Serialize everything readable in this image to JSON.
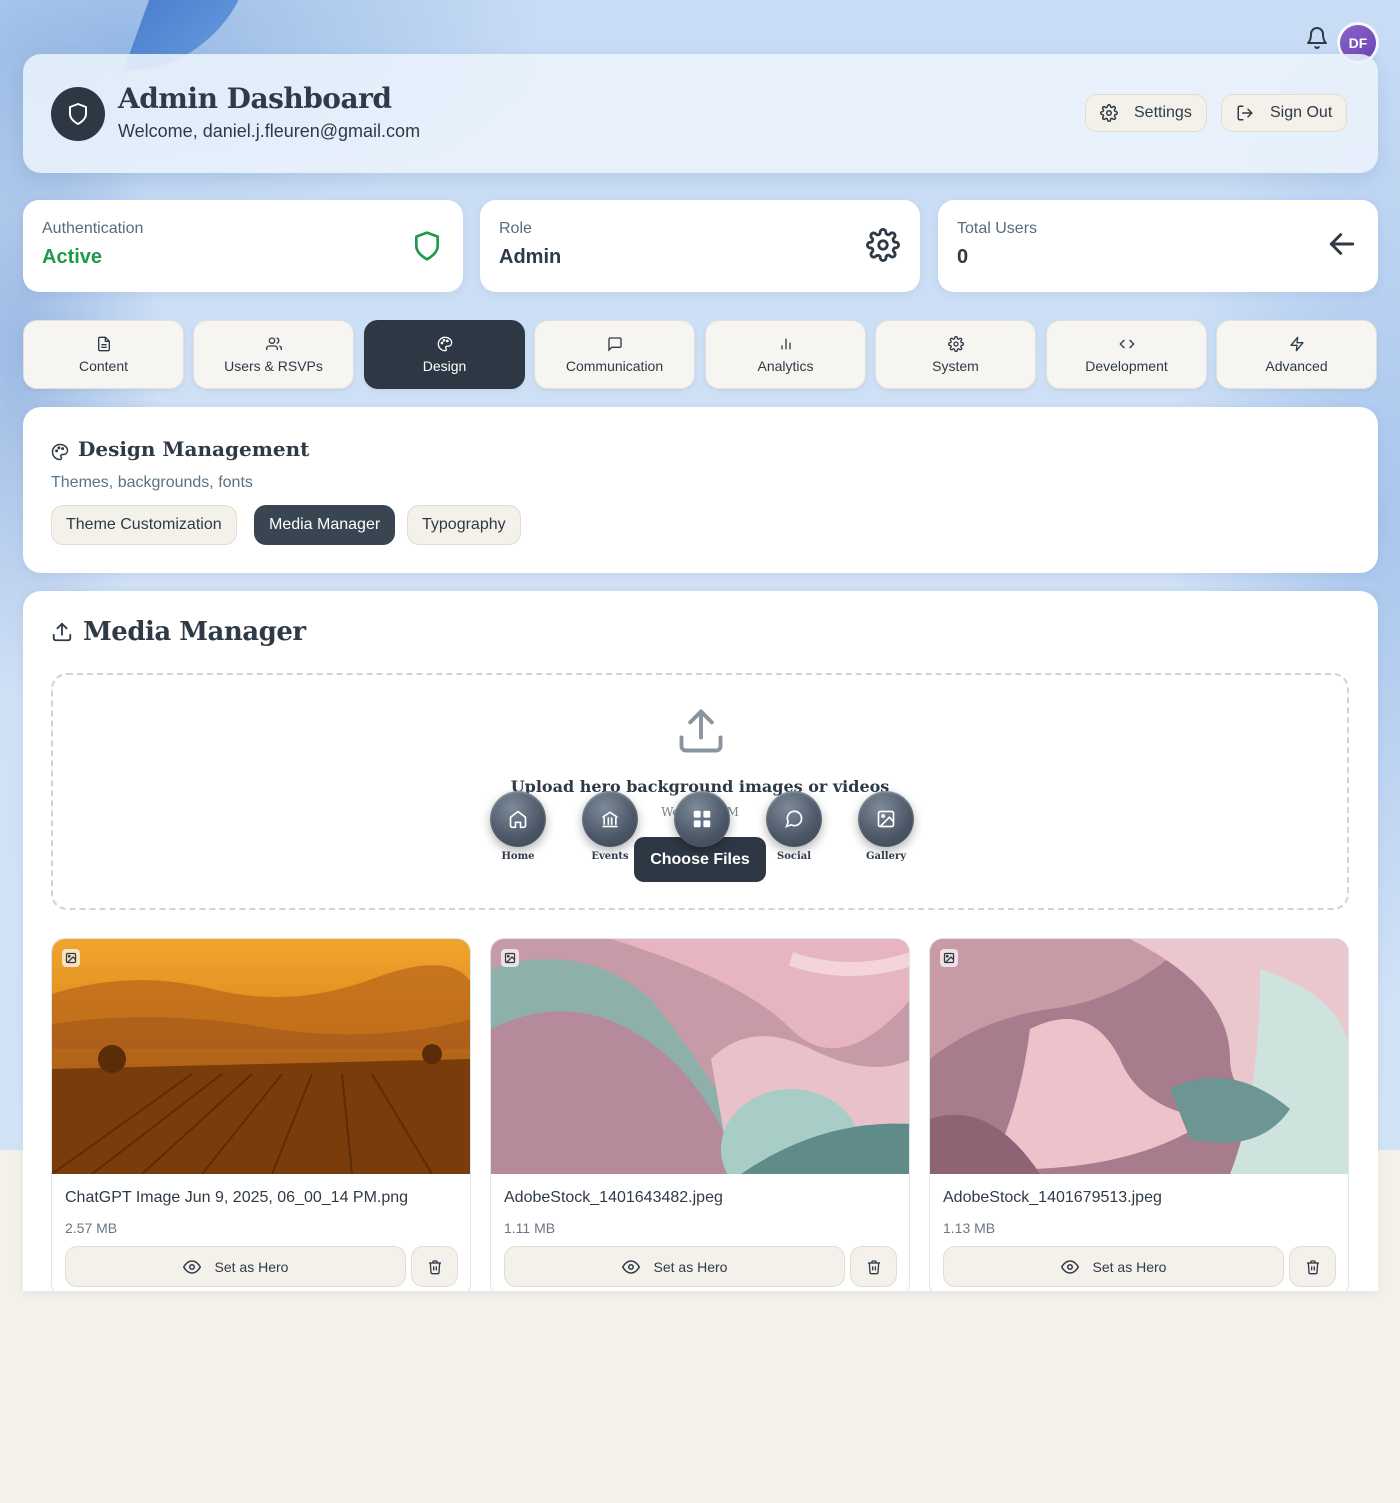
{
  "user": {
    "initials": "DF"
  },
  "header": {
    "title": "Admin Dashboard",
    "welcome": "Welcome, daniel.j.fleuren@gmail.com",
    "settings_label": "Settings",
    "signout_label": "Sign Out"
  },
  "stats": [
    {
      "label": "Authentication",
      "value": "Active",
      "icon": "shield-icon",
      "value_color": "#1f9a4a"
    },
    {
      "label": "Role",
      "value": "Admin",
      "icon": "gear-icon"
    },
    {
      "label": "Total Users",
      "value": "0",
      "icon": "arrow-left-icon"
    }
  ],
  "nav_tabs": [
    {
      "label": "Content",
      "icon": "document-icon"
    },
    {
      "label": "Users & RSVPs",
      "icon": "users-icon"
    },
    {
      "label": "Design",
      "icon": "palette-icon",
      "active": true
    },
    {
      "label": "Communication",
      "icon": "chat-icon"
    },
    {
      "label": "Analytics",
      "icon": "bar-chart-icon"
    },
    {
      "label": "System",
      "icon": "gear-icon"
    },
    {
      "label": "Development",
      "icon": "code-icon"
    },
    {
      "label": "Advanced",
      "icon": "bolt-icon"
    }
  ],
  "design": {
    "title": "Design Management",
    "subtitle": "Themes, backgrounds, fonts",
    "subtabs": [
      {
        "label": "Theme Customization"
      },
      {
        "label": "Media Manager",
        "active": true
      },
      {
        "label": "Typography"
      }
    ]
  },
  "media": {
    "title": "Media Manager",
    "upload_title": "Upload hero background images or videos",
    "upload_sub": "WebP, WebM",
    "choose_label": "Choose Files",
    "float_nav": [
      {
        "label": "Home",
        "icon": "home-icon"
      },
      {
        "label": "Events",
        "icon": "bank-icon"
      },
      {
        "label": "",
        "icon": "grid-icon"
      },
      {
        "label": "Social",
        "icon": "chat-icon"
      },
      {
        "label": "Gallery",
        "icon": "image-icon"
      }
    ],
    "items": [
      {
        "name": "ChatGPT Image Jun 9, 2025, 06_00_14 PM.png",
        "size": "2.57 MB",
        "hero_label": "Set as Hero"
      },
      {
        "name": "AdobeStock_1401643482.jpeg",
        "size": "1.11 MB",
        "hero_label": "Set as Hero"
      },
      {
        "name": "AdobeStock_1401679513.jpeg",
        "size": "1.13 MB",
        "hero_label": "Set as Hero"
      }
    ]
  },
  "colors": {
    "dark": "#2e3844",
    "accent_green": "#1f9a4a",
    "cream": "#f4f1ea"
  }
}
